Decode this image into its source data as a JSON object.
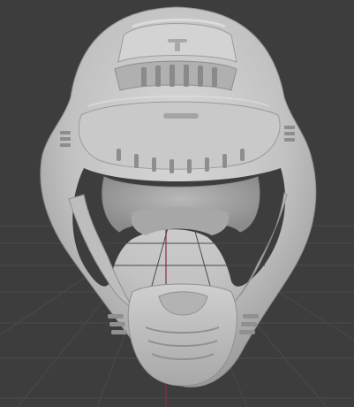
{
  "viewport": {
    "view": "perspective",
    "background_color": "#3d3d3d",
    "grid_color": "#4a4a4a",
    "axis_color": "#8a2f3c",
    "object": "helmet-model",
    "object_color": "#c7c7c7"
  }
}
